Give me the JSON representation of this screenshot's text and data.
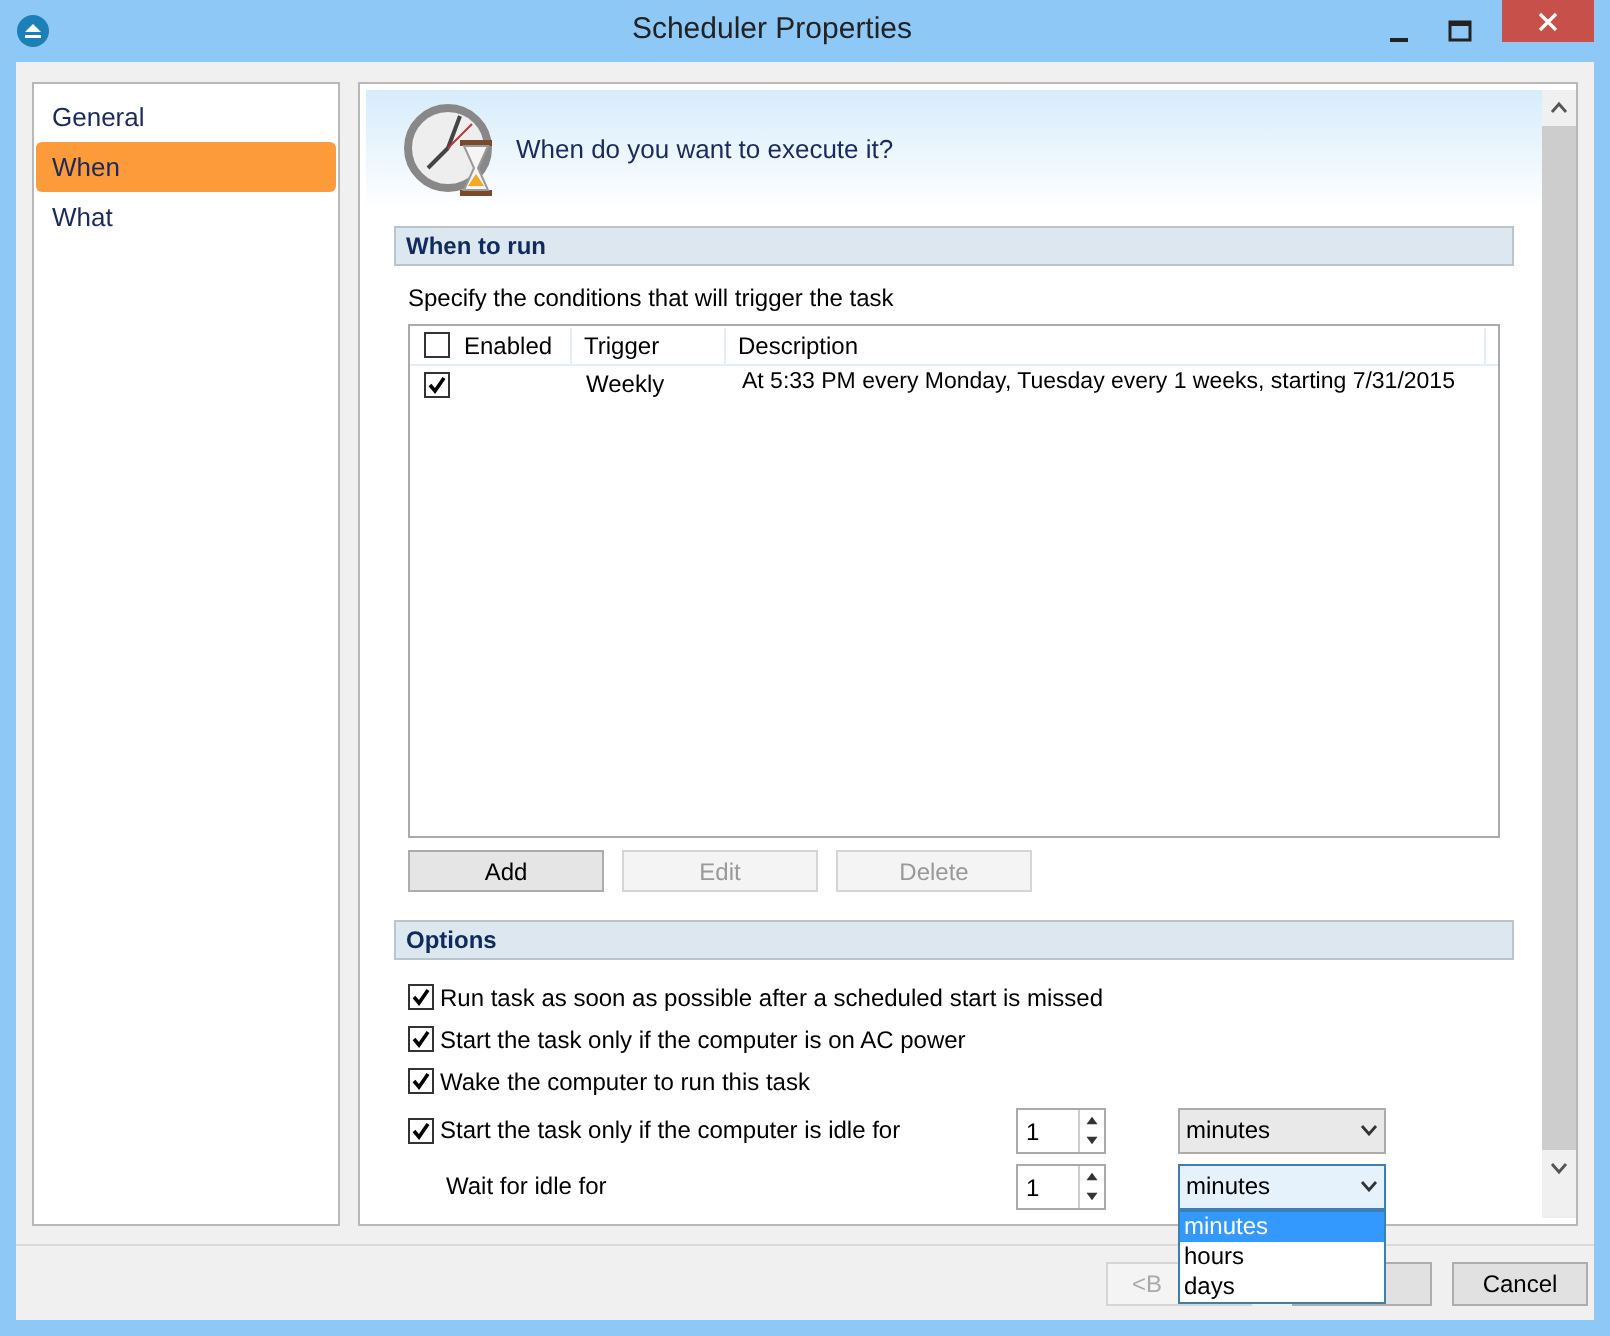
{
  "window": {
    "title": "Scheduler Properties"
  },
  "sidebar": {
    "items": [
      {
        "label": "General",
        "selected": false
      },
      {
        "label": "When",
        "selected": true
      },
      {
        "label": "What",
        "selected": false
      }
    ]
  },
  "header": {
    "title": "When do you want to execute it?"
  },
  "when_to_run": {
    "heading": "When to run",
    "instruction": "Specify the conditions that will trigger the task",
    "table": {
      "all_checked": false,
      "columns": [
        "Enabled",
        "Trigger",
        "Description"
      ],
      "rows": [
        {
          "enabled": true,
          "trigger": "Weekly",
          "description": "At 5:33 PM every Monday, Tuesday every 1 weeks, starting 7/31/2015"
        }
      ]
    },
    "buttons": [
      {
        "label": "Add",
        "disabled": false
      },
      {
        "label": "Edit",
        "disabled": true
      },
      {
        "label": "Delete",
        "disabled": true
      }
    ]
  },
  "options": {
    "heading": "Options",
    "items": [
      {
        "kind": "checkbox",
        "label": "Run task as soon as possible after a scheduled start is missed",
        "checked": true
      },
      {
        "kind": "checkbox",
        "label": "Start the task only if the computer is on AC power",
        "checked": true
      },
      {
        "kind": "checkbox",
        "label": "Wake the computer to run this task",
        "checked": true
      },
      {
        "kind": "checkbox",
        "label": "Start the task only if the computer is idle for",
        "checked": true,
        "amount": "1",
        "unit": "minutes",
        "open": false
      },
      {
        "kind": "label",
        "label": "Wait for idle for",
        "amount": "1",
        "unit": "minutes",
        "open": true
      }
    ]
  },
  "dropdown_menu": {
    "options": [
      {
        "label": "minutes",
        "selected": true
      },
      {
        "label": "hours",
        "selected": false
      },
      {
        "label": "days",
        "selected": false
      }
    ]
  },
  "footer": {
    "buttons": [
      {
        "label": "<B",
        "disabled": true
      },
      {
        "label": "Cancel",
        "disabled": false
      }
    ]
  }
}
